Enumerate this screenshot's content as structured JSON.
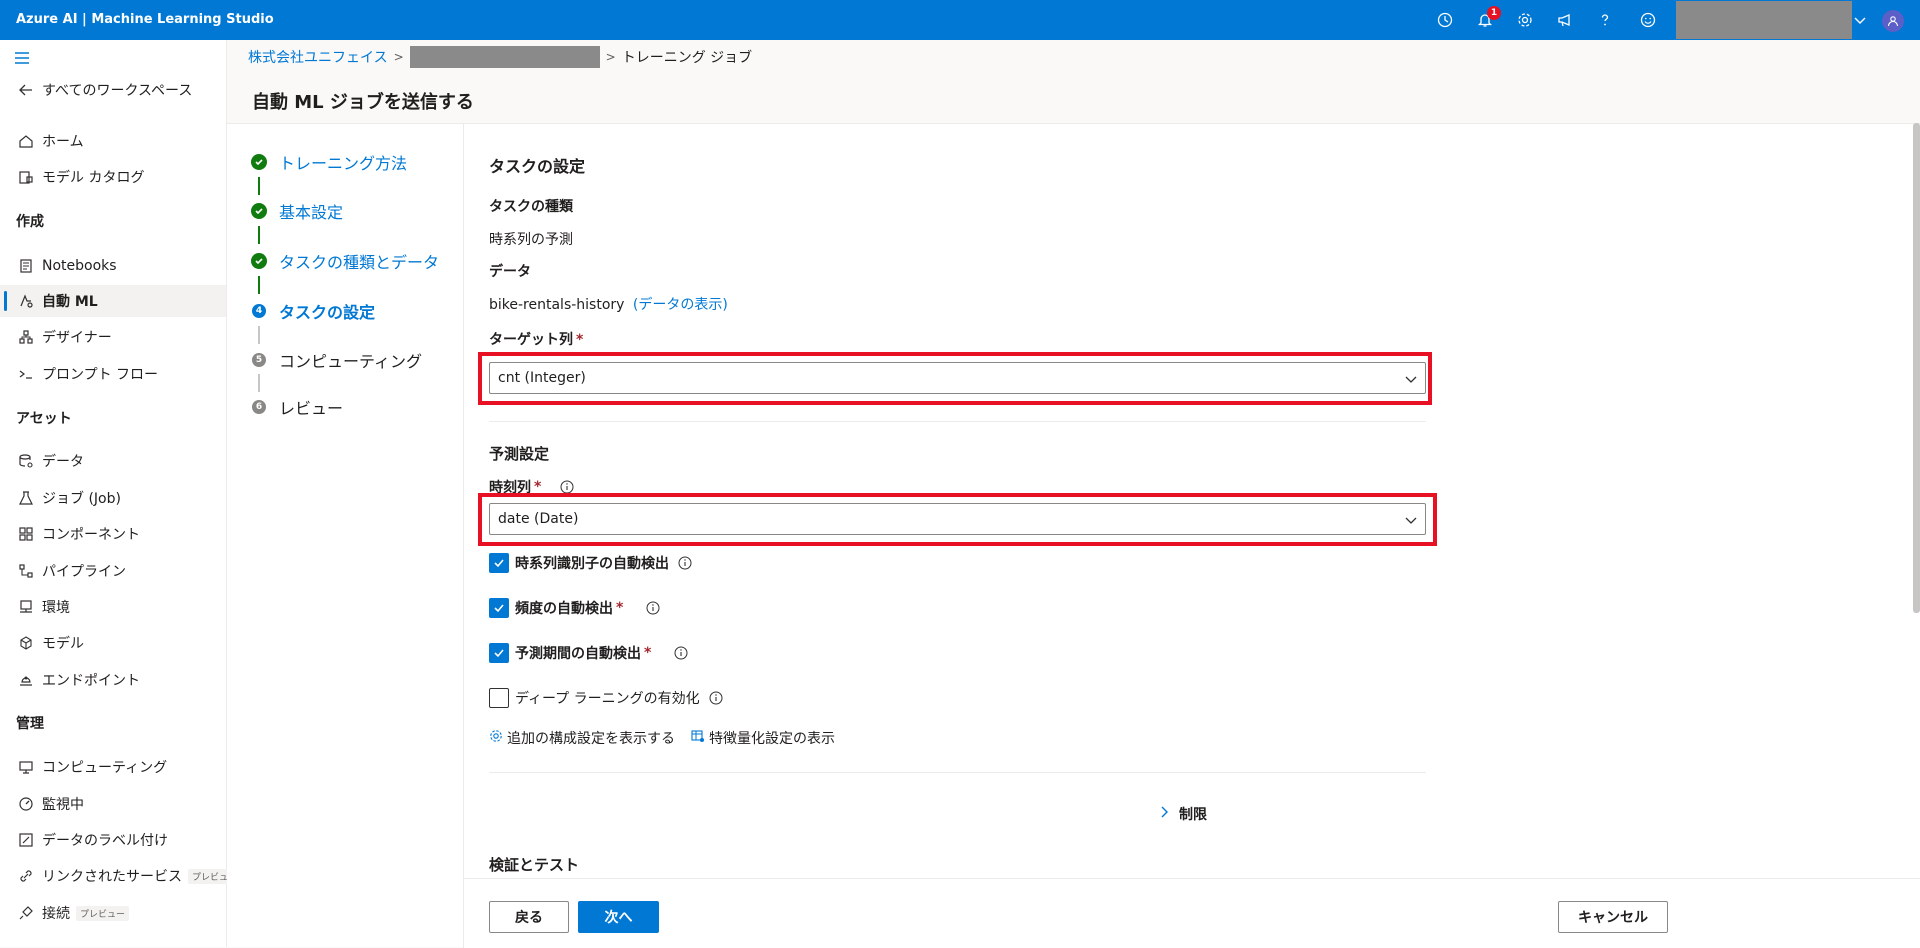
{
  "app": {
    "title": "Azure AI | Machine Learning Studio",
    "notification_count": "1"
  },
  "sidebar": {
    "back_label": "すべてのワークスペース",
    "items_top": [
      {
        "label": "ホーム",
        "icon": "home-icon"
      },
      {
        "label": "モデル カタログ",
        "icon": "catalog-icon"
      }
    ],
    "section_author": "作成",
    "items_author": [
      {
        "label": "Notebooks",
        "icon": "notebook-icon"
      },
      {
        "label": "自動 ML",
        "icon": "automl-icon"
      },
      {
        "label": "デザイナー",
        "icon": "designer-icon"
      },
      {
        "label": "プロンプト フロー",
        "icon": "prompt-flow-icon"
      }
    ],
    "section_assets": "アセット",
    "items_assets": [
      {
        "label": "データ",
        "icon": "data-icon"
      },
      {
        "label": "ジョブ (Job)",
        "icon": "flask-icon"
      },
      {
        "label": "コンポーネント",
        "icon": "component-icon"
      },
      {
        "label": "パイプライン",
        "icon": "pipeline-icon"
      },
      {
        "label": "環境",
        "icon": "environment-icon"
      },
      {
        "label": "モデル",
        "icon": "model-icon"
      },
      {
        "label": "エンドポイント",
        "icon": "endpoint-icon"
      }
    ],
    "section_manage": "管理",
    "items_manage": [
      {
        "label": "コンピューティング",
        "icon": "compute-icon"
      },
      {
        "label": "監視中",
        "icon": "monitor-icon"
      },
      {
        "label": "データのラベル付け",
        "icon": "label-icon"
      },
      {
        "label": "リンクされたサービス",
        "icon": "link-icon",
        "tag": "プレビュー"
      },
      {
        "label": "接続",
        "icon": "connection-icon",
        "tag": "プレビュー"
      }
    ]
  },
  "breadcrumb": {
    "root": "株式会社ユニフェイス",
    "current": "トレーニング ジョブ"
  },
  "page_title": "自動 ML ジョブを送信する",
  "steps": [
    {
      "label": "トレーニング方法",
      "state": "done",
      "num": ""
    },
    {
      "label": "基本設定",
      "state": "done",
      "num": ""
    },
    {
      "label": "タスクの種類とデータ",
      "state": "done",
      "num": ""
    },
    {
      "label": "タスクの設定",
      "state": "current",
      "num": "4"
    },
    {
      "label": "コンピューティング",
      "state": "todo",
      "num": "5"
    },
    {
      "label": "レビュー",
      "state": "todo",
      "num": "6"
    }
  ],
  "task_settings": {
    "heading": "タスクの設定",
    "task_type_label": "タスクの種類",
    "task_type_value": "時系列の予測",
    "data_label": "データ",
    "data_value": "bike-rentals-history",
    "data_view_link": "(データの表示)",
    "target_label": "ターゲット列",
    "target_value": "cnt (Integer)"
  },
  "forecast": {
    "heading": "予測設定",
    "time_col_label": "時刻列",
    "time_col_value": "date (Date)",
    "checkboxes": [
      {
        "label": "時系列識別子の自動検出",
        "checked": true,
        "required": false
      },
      {
        "label": "頻度の自動検出",
        "checked": true,
        "required": true
      },
      {
        "label": "予測期間の自動検出",
        "checked": true,
        "required": true
      },
      {
        "label": "ディープ ラーニングの有効化",
        "checked": false,
        "required": false
      }
    ],
    "extra_config_link": "追加の構成設定を表示する",
    "featurization_link": "特徴量化設定の表示"
  },
  "limits_label": "制限",
  "validation_heading": "検証とテスト",
  "footer": {
    "back": "戻る",
    "next": "次へ",
    "cancel": "キャンセル"
  },
  "colors": {
    "brand": "#0078d4",
    "success": "#107c10",
    "highlight": "#e81123"
  }
}
